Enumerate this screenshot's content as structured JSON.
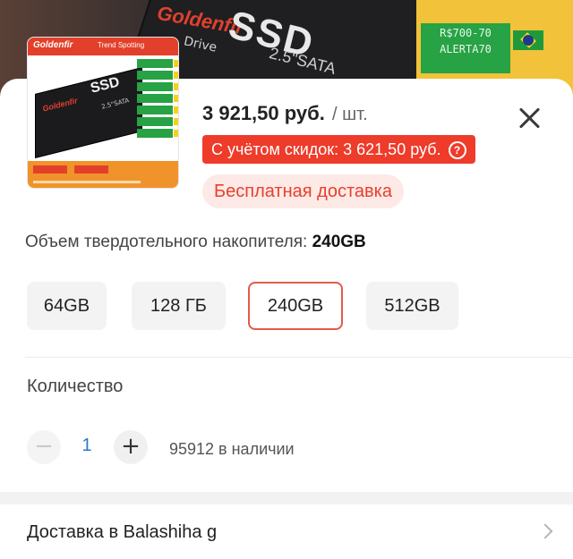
{
  "background": {
    "image_brand": "Goldenfir",
    "image_drive": "Drive",
    "image_ssd": "SSD",
    "image_sub": "2.5\"SATA",
    "coupon_line1": "R$700-70",
    "coupon_line2": "ALERTA70"
  },
  "product": {
    "thumb_brand": "Goldenfir",
    "thumb_trend": "Trend Spotting",
    "thumb_ssd": "SSD",
    "thumb_sub": "2.5\"SATA",
    "price": "3 921,50 руб.",
    "price_unit": "/ шт.",
    "discount_text": "С учётом скидок: 3 621,50 руб.",
    "discount_help_icon": "?",
    "shipping": "Бесплатная доставка"
  },
  "variant": {
    "label": "Объем твердотельного накопителя:",
    "selected_value": "240GB",
    "options": [
      "64GB",
      "128 ГБ",
      "240GB",
      "512GB"
    ]
  },
  "quantity": {
    "label": "Количество",
    "minus": "−",
    "value": "1",
    "plus": "+",
    "stock": "95912 в наличии"
  },
  "delivery": {
    "text": "Доставка в Balashiha g"
  },
  "colors": {
    "accent": "#ee3b2a",
    "shipping_bg": "#fde9e6",
    "selected_border": "#e25b4a",
    "qty_value": "#2a78c8"
  }
}
